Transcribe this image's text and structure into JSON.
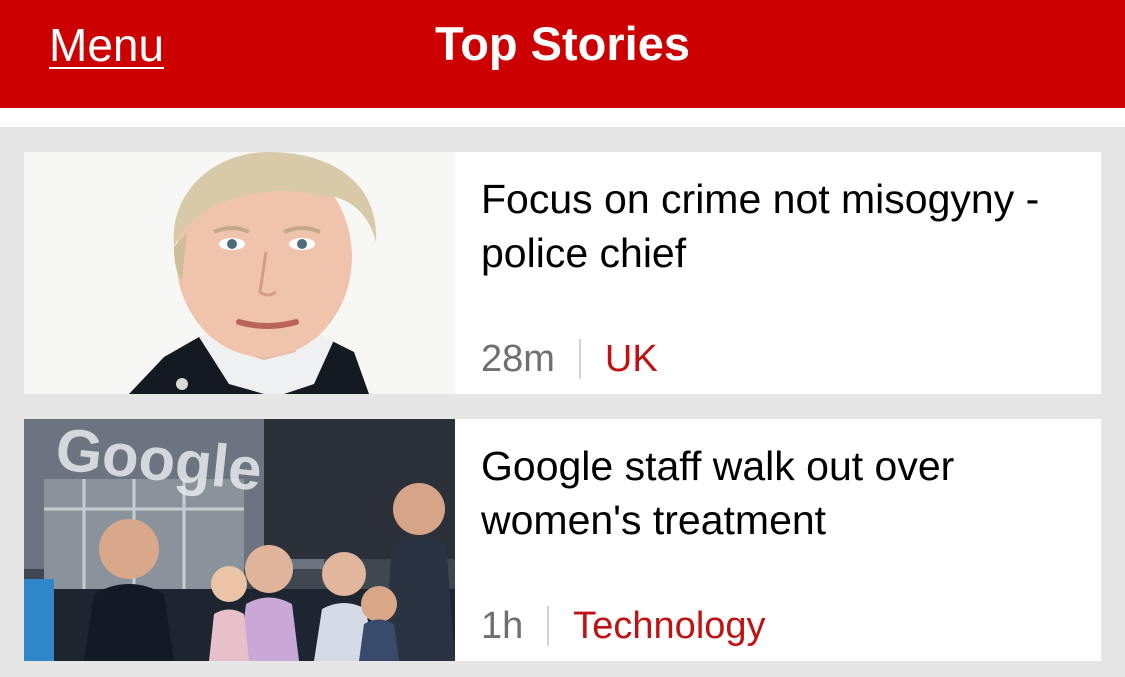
{
  "header": {
    "menu_label": "Menu",
    "title": "Top Stories"
  },
  "stories": [
    {
      "headline": "Focus on crime not misogyny - police chief",
      "time": "28m",
      "section": "UK",
      "thumbnail": "police-chief-portrait-image"
    },
    {
      "headline": "Google staff walk out over women's treatment",
      "time": "1h",
      "section": "Technology",
      "thumbnail": "google-walkout-photo-image",
      "thumbnail_sign_text": "Google"
    }
  ],
  "colors": {
    "header_bg": "#cc0000",
    "section_text": "#c01212",
    "time_text": "#6f6f6f",
    "page_bg": "#e6e6e6"
  }
}
